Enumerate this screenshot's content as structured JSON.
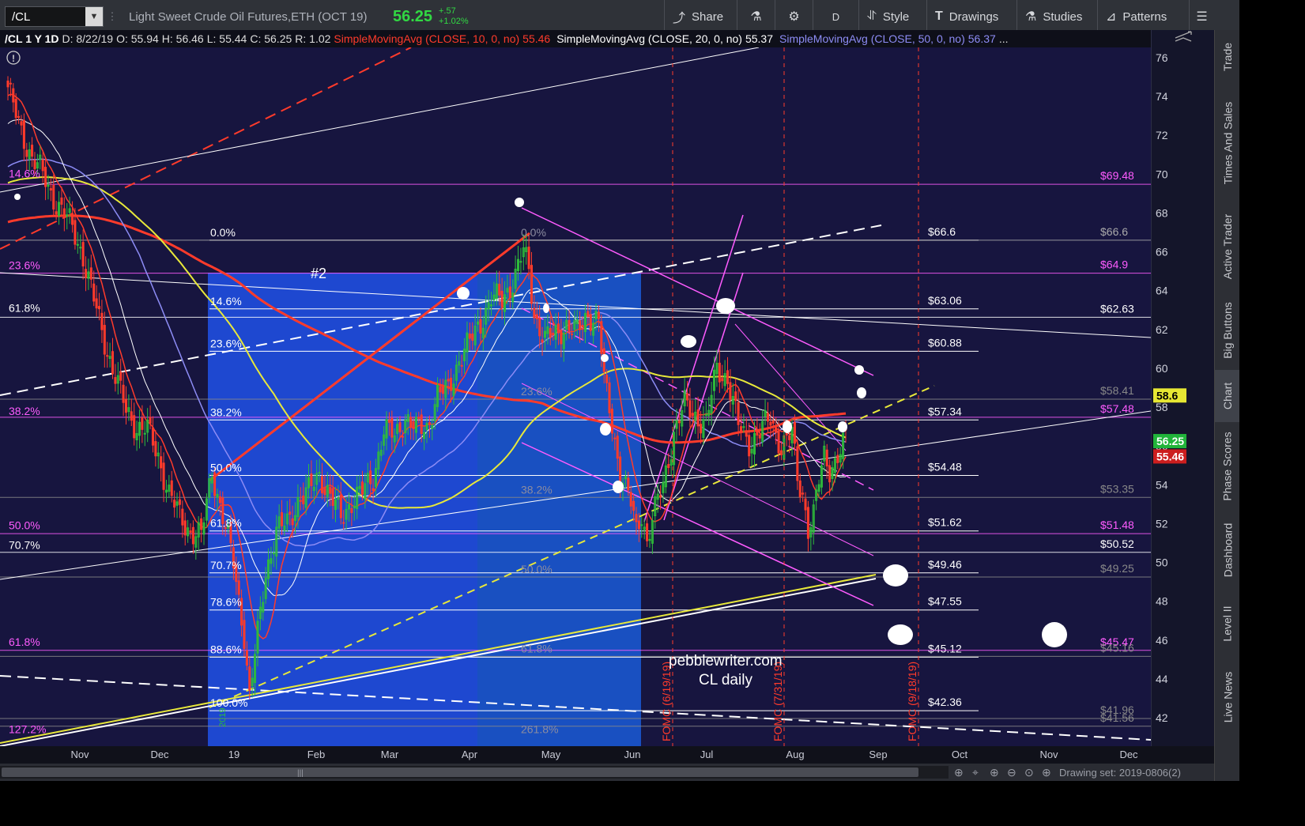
{
  "toolbar": {
    "symbol": "/CL",
    "description": "Light Sweet Crude Oil Futures,ETH (OCT 19)",
    "last_price": "56.25",
    "change_abs": "+.57",
    "change_pct": "+1.02%",
    "share": "Share",
    "aggregation": "D",
    "style": "Style",
    "drawings": "Drawings",
    "studies": "Studies",
    "patterns": "Patterns"
  },
  "legend": {
    "header": "/CL 1 Y 1D",
    "date": "D: 8/22/19",
    "open": "O: 55.94",
    "high": "H: 56.46",
    "low": "L: 55.44",
    "close": "C: 56.25",
    "range": "R: 1.02",
    "sma10_label": "SimpleMovingAvg (CLOSE, 10, 0, no)",
    "sma10_value": "55.46",
    "sma20_label": "SimpleMovingAvg (CLOSE, 20, 0, no)",
    "sma20_value": "55.37",
    "sma50_label": "SimpleMovingAvg (CLOSE, 50, 0, no)",
    "sma50_value": "56.37",
    "more": "..."
  },
  "colors": {
    "sma10": "#ff3b2b",
    "sma20": "#ffffff",
    "sma50": "#8d8cf5",
    "sma200": "#ff3b2b",
    "sma100": "#e8e83a",
    "fib_magenta": "#ff5cff",
    "up": "#2ebd3a",
    "down": "#ff3b2b",
    "plot_bg": "#17153f",
    "highlight_dark": "#1e48d0",
    "highlight_light": "#1a62e6"
  },
  "chart_data": {
    "type": "line",
    "title": "",
    "ylim": [
      40.8,
      77
    ],
    "y_ticks": [
      "76",
      "74",
      "72",
      "70",
      "68",
      "66",
      "64",
      "62",
      "60",
      "58",
      "56",
      "54",
      "52",
      "50",
      "48",
      "46",
      "44",
      "42"
    ],
    "x_ticks": [
      "Nov",
      "Dec",
      "19",
      "Feb",
      "Mar",
      "Apr",
      "May",
      "Jun",
      "Jul",
      "Aug",
      "Sep",
      "Oct",
      "Nov",
      "Dec"
    ],
    "price_path": [
      [
        0,
        74.5
      ],
      [
        4,
        72.5
      ],
      [
        8,
        71.2
      ],
      [
        12,
        70.2
      ],
      [
        16,
        69.0
      ],
      [
        20,
        68.2
      ],
      [
        24,
        67.2
      ],
      [
        28,
        65.8
      ],
      [
        32,
        63.5
      ],
      [
        36,
        61.4
      ],
      [
        40,
        59.6
      ],
      [
        44,
        57.8
      ],
      [
        48,
        57.0
      ],
      [
        52,
        56.8
      ],
      [
        56,
        55.5
      ],
      [
        60,
        53.5
      ],
      [
        64,
        52.4
      ],
      [
        68,
        51.6
      ],
      [
        72,
        51.3
      ],
      [
        76,
        54.8
      ],
      [
        80,
        52.3
      ],
      [
        84,
        50.0
      ],
      [
        88,
        46.3
      ],
      [
        90,
        43.0
      ],
      [
        92,
        45.2
      ],
      [
        96,
        49.5
      ],
      [
        100,
        51.6
      ],
      [
        104,
        52.0
      ],
      [
        108,
        53.2
      ],
      [
        112,
        53.6
      ],
      [
        116,
        54.6
      ],
      [
        120,
        53.4
      ],
      [
        124,
        52.3
      ],
      [
        128,
        53.2
      ],
      [
        132,
        53.6
      ],
      [
        136,
        54.4
      ],
      [
        140,
        56.8
      ],
      [
        144,
        56.5
      ],
      [
        148,
        57.5
      ],
      [
        152,
        56.8
      ],
      [
        156,
        57.0
      ],
      [
        160,
        58.6
      ],
      [
        164,
        58.9
      ],
      [
        168,
        60.5
      ],
      [
        172,
        61.3
      ],
      [
        176,
        62.4
      ],
      [
        180,
        63.6
      ],
      [
        184,
        63.5
      ],
      [
        188,
        64.5
      ],
      [
        192,
        66.0
      ],
      [
        194,
        65.0
      ],
      [
        196,
        62.8
      ],
      [
        200,
        61.5
      ],
      [
        204,
        61.7
      ],
      [
        208,
        62.3
      ],
      [
        212,
        61.8
      ],
      [
        216,
        62.8
      ],
      [
        220,
        62.5
      ],
      [
        222,
        59.3
      ],
      [
        224,
        57.9
      ],
      [
        228,
        54.7
      ],
      [
        232,
        53.0
      ],
      [
        234,
        51.6
      ],
      [
        236,
        52.6
      ],
      [
        238,
        51.1
      ],
      [
        240,
        52.2
      ],
      [
        244,
        54.0
      ],
      [
        248,
        56.7
      ],
      [
        252,
        58.1
      ],
      [
        256,
        57.6
      ],
      [
        260,
        57.1
      ],
      [
        264,
        60.0
      ],
      [
        268,
        59.5
      ],
      [
        272,
        57.0
      ],
      [
        276,
        56.2
      ],
      [
        280,
        56.7
      ],
      [
        284,
        57.4
      ],
      [
        288,
        56.0
      ],
      [
        292,
        56.6
      ],
      [
        294,
        54.3
      ],
      [
        296,
        53.6
      ],
      [
        298,
        51.8
      ],
      [
        300,
        52.4
      ],
      [
        302,
        54.1
      ],
      [
        304,
        55.5
      ],
      [
        306,
        54.9
      ],
      [
        308,
        55.2
      ],
      [
        310,
        55.7
      ],
      [
        312,
        56.25
      ]
    ],
    "trading_days": 313,
    "overlays": [
      {
        "name": "SimpleMovingAvg (CLOSE, 10, 0, no)",
        "last_value": 55.46
      },
      {
        "name": "SimpleMovingAvg (CLOSE, 20, 0, no)",
        "last_value": 55.37
      },
      {
        "name": "SimpleMovingAvg (CLOSE, 50, 0, no)",
        "last_value": 56.37
      }
    ],
    "price_markers": [
      {
        "label": "56.25",
        "value": 56.25,
        "color": "#21b43a"
      },
      {
        "label": "55.46",
        "value": 55.46,
        "color": "#cc1e1e"
      },
      {
        "label": "58.6",
        "value": 58.6,
        "color": "#e7e733"
      }
    ],
    "right_levels": [
      {
        "label": "$69.48",
        "value": 69.48,
        "color": "#ff5cff"
      },
      {
        "label": "$66.6",
        "value": 66.6,
        "color": "#aaaaaa"
      },
      {
        "label": "$64.9",
        "value": 64.9,
        "color": "#ff5cff"
      },
      {
        "label": "$62.63",
        "value": 62.63,
        "color": "#ffffff"
      },
      {
        "label": "$58.41",
        "value": 58.41,
        "color": "#888888"
      },
      {
        "label": "$57.48",
        "value": 57.48,
        "color": "#ff5cff"
      },
      {
        "label": "$53.35",
        "value": 53.35,
        "color": "#888888"
      },
      {
        "label": "$51.48",
        "value": 51.48,
        "color": "#ff5cff"
      },
      {
        "label": "$50.52",
        "value": 50.52,
        "color": "#ffffff"
      },
      {
        "label": "$49.25",
        "value": 49.25,
        "color": "#888888"
      },
      {
        "label": "$45.47",
        "value": 45.47,
        "color": "#ff5cff"
      },
      {
        "label": "$45.16",
        "value": 45.16,
        "color": "#888888"
      },
      {
        "label": "$41.56",
        "value": 41.56,
        "color": "#888888"
      },
      {
        "label": "$41.96",
        "value": 41.96,
        "color": "#888888"
      }
    ],
    "mid_levels": [
      {
        "label": "$66.6",
        "value": 66.6
      },
      {
        "label": "$63.06",
        "value": 63.06
      },
      {
        "label": "$60.88",
        "value": 60.88
      },
      {
        "label": "$57.34",
        "value": 57.34
      },
      {
        "label": "$54.48",
        "value": 54.48
      },
      {
        "label": "$51.62",
        "value": 51.62
      },
      {
        "label": "$49.46",
        "value": 49.46
      },
      {
        "label": "$47.55",
        "value": 47.55
      },
      {
        "label": "$45.12",
        "value": 45.12
      },
      {
        "label": "$42.36",
        "value": 42.36
      }
    ],
    "fib_left_outer": [
      {
        "label": "14.6%",
        "value": 69.62
      },
      {
        "label": "23.6%",
        "value": 64.9
      },
      {
        "label": "61.8%",
        "value": 62.7
      },
      {
        "label": "38.2%",
        "value": 57.4
      },
      {
        "label": "50.0%",
        "value": 51.5
      },
      {
        "label": "70.7%",
        "value": 50.5
      },
      {
        "label": "61.8%",
        "value": 45.5
      },
      {
        "label": "127.2%",
        "value": 41.0
      }
    ],
    "fib_left_inner": [
      {
        "label": "0.0%",
        "value": 66.6
      },
      {
        "label": "14.6%",
        "value": 63.06
      },
      {
        "label": "23.6%",
        "value": 60.88
      },
      {
        "label": "38.2%",
        "value": 57.34
      },
      {
        "label": "50.0%",
        "value": 54.48
      },
      {
        "label": "61.8%",
        "value": 51.62
      },
      {
        "label": "70.7%",
        "value": 49.46
      },
      {
        "label": "78.6%",
        "value": 47.55
      },
      {
        "label": "88.6%",
        "value": 45.12
      },
      {
        "label": "100.0%",
        "value": 42.36
      }
    ],
    "fib_mid": [
      {
        "label": "0.0%",
        "value": 66.6
      },
      {
        "label": "23.6%",
        "value": 58.41
      },
      {
        "label": "38.2%",
        "value": 53.35
      },
      {
        "label": "50.0%",
        "value": 49.25
      },
      {
        "label": "61.8%",
        "value": 45.16
      },
      {
        "label": "261.8%",
        "value": 41.0
      }
    ],
    "event_labels": [
      "FOMC (6/19/19)",
      "FOMC (7/31/19)",
      "FOMC (9/18/19)"
    ],
    "annotation_hash": "#2",
    "watermark_line1": "pebblewriter.com",
    "watermark_line2": "CL daily",
    "small_rotated": "2019"
  },
  "sidebar_tabs": [
    "Trade",
    "Times And Sales",
    "Active Trader",
    "Big Buttons",
    "Chart",
    "Phase Scores",
    "Dashboard",
    "Level II",
    "Live News"
  ],
  "bottom": {
    "drawing_set": "Drawing set: 2019-0806(2)"
  }
}
